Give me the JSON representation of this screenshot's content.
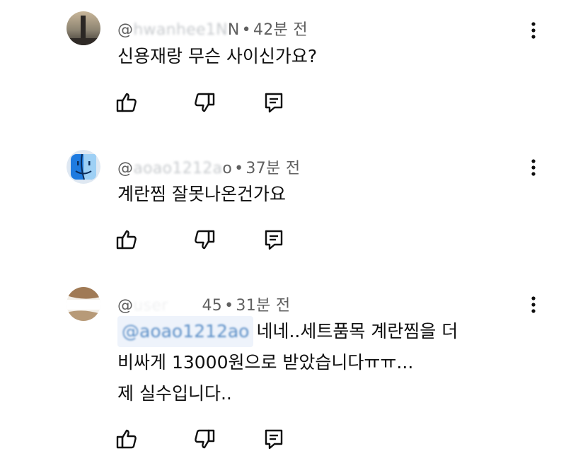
{
  "comments": [
    {
      "handle_prefix": "@",
      "handle_hidden": "hwanhee1N",
      "handle_visible_tail": "N",
      "time": "42분 전",
      "lines": [
        "신용재랑 무슨 사이신가요?"
      ],
      "avatar": "sunset-photo"
    },
    {
      "handle_prefix": "@",
      "handle_hidden": "aoao1212a",
      "handle_visible_tail": "o",
      "time": "37분 전",
      "lines": [
        "계란찜 잘못나온건가요"
      ],
      "avatar": "finder-face"
    },
    {
      "handle_prefix": "@",
      "handle_hidden": "user",
      "handle_visible_tail": "45",
      "time": "31분 전",
      "mention": "@aoao1212ao",
      "lines": [
        "네네..세트품목 계란찜을 더",
        "비싸게 13000원으로 받았습니다ㅠㅠ...",
        "제 실수입니다.."
      ],
      "avatar": "photo-avatar"
    }
  ],
  "separator": "•",
  "icons": {
    "like": "thumb-up-icon",
    "dislike": "thumb-down-icon",
    "reply": "reply-icon",
    "more": "more-vertical-icon"
  }
}
